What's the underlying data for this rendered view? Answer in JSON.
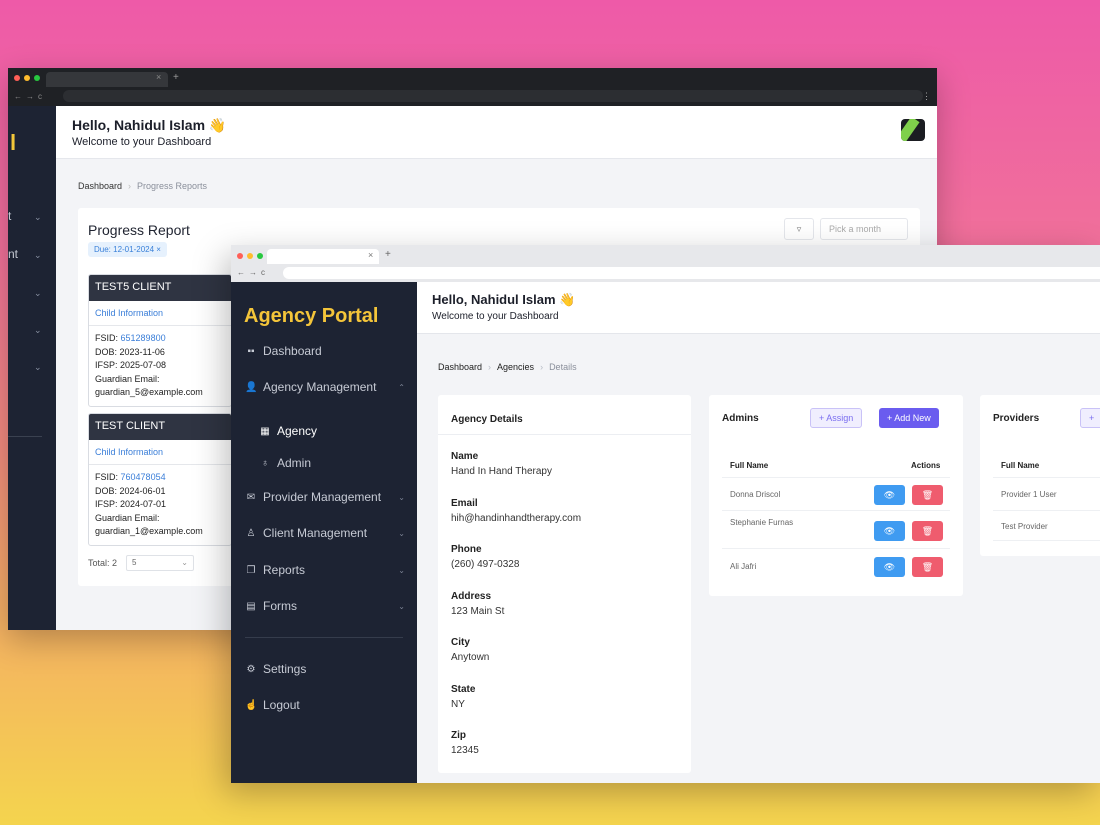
{
  "back": {
    "sidebar_fragments": [
      "l",
      "t",
      "nt"
    ],
    "hello": "Hello, Nahidul Islam 👋",
    "welcome": "Welcome to your Dashboard",
    "breadcrumb": {
      "root": "Dashboard",
      "current": "Progress Reports"
    },
    "title": "Progress Report",
    "chip": "Due: 12-01-2024 ×",
    "filter_icon": "▿",
    "month_placeholder": "Pick a month",
    "clients": [
      {
        "name": "TEST5 CLIENT",
        "section": "Child Information",
        "fsid_label": "FSID:",
        "fsid": "651289800",
        "dob": "DOB: 2023-11-06",
        "ifsp": "IFSP: 2025-07-08",
        "guardian_label": "Guardian Email:",
        "guardian_email": "guardian_5@example.com"
      },
      {
        "name": "TEST CLIENT",
        "section": "Child Information",
        "fsid_label": "FSID:",
        "fsid": "760478054",
        "dob": "DOB: 2024-06-01",
        "ifsp": "IFSP: 2024-07-01",
        "guardian_label": "Guardian Email:",
        "guardian_email": "guardian_1@example.com"
      }
    ],
    "total": "Total: 2",
    "page_size": "5"
  },
  "front": {
    "logo": "Agency Portal",
    "hello": "Hello, Nahidul Islam 👋",
    "welcome": "Welcome to your Dashboard",
    "sidebar": {
      "dashboard": "Dashboard",
      "agency_management": "Agency Management",
      "agency": "Agency",
      "admin": "Admin",
      "provider_management": "Provider Management",
      "client_management": "Client Management",
      "reports": "Reports",
      "forms": "Forms",
      "settings": "Settings",
      "logout": "Logout"
    },
    "breadcrumb": {
      "root": "Dashboard",
      "middle": "Agencies",
      "current": "Details"
    },
    "details": {
      "title": "Agency Details",
      "fields": [
        {
          "label": "Name",
          "value": "Hand In Hand Therapy"
        },
        {
          "label": "Email",
          "value": "hih@handinhandtherapy.com"
        },
        {
          "label": "Phone",
          "value": "(260) 497-0328"
        },
        {
          "label": "Address",
          "value": "123 Main St"
        },
        {
          "label": "City",
          "value": "Anytown"
        },
        {
          "label": "State",
          "value": "NY"
        },
        {
          "label": "Zip",
          "value": "12345"
        }
      ]
    },
    "admins": {
      "title": "Admins",
      "assign": "+ Assign",
      "add_new": "+ Add New",
      "col_name": "Full Name",
      "col_actions": "Actions",
      "rows": [
        "Donna Driscol",
        "Stephanie Furnas",
        "Ali Jafri"
      ]
    },
    "providers": {
      "title": "Providers",
      "col_name": "Full Name",
      "rows": [
        "Provider 1 User",
        "Test Provider"
      ]
    },
    "colors": {
      "sidebar": "#1d2333",
      "logo": "#f4c53a",
      "primary": "#6a5cef",
      "view": "#3f9bf1",
      "delete": "#ef5c6e"
    }
  }
}
